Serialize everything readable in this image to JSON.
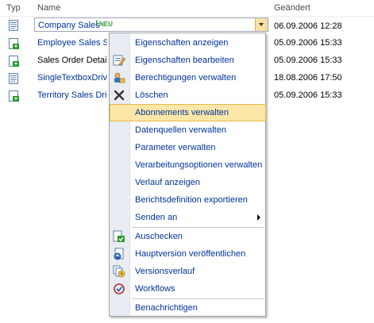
{
  "header": {
    "type_label": "Typ",
    "name_label": "Name",
    "changed_label": "Geändert"
  },
  "rows": [
    {
      "name": "Company Sales",
      "date": "06.09.2006 12:28",
      "badge": "NEU",
      "badge_mark": "!"
    },
    {
      "name": "Employee Sales Su",
      "date": "05.09.2006 15:33"
    },
    {
      "name": "Sales Order Detail",
      "date": "05.09.2006 15:33"
    },
    {
      "name": "SingleTextboxDrive",
      "date": "18.08.2006 17:50"
    },
    {
      "name": "Territory Sales Drill",
      "date": "05.09.2006 15:33"
    }
  ],
  "menu": {
    "items": [
      {
        "label": "Eigenschaften anzeigen",
        "icon": "none"
      },
      {
        "label": "Eigenschaften bearbeiten",
        "icon": "edit-properties-icon"
      },
      {
        "label": "Berechtigungen verwalten",
        "icon": "permissions-icon"
      },
      {
        "label": "Löschen",
        "icon": "delete-x-icon"
      },
      {
        "label": "Abonnements verwalten",
        "icon": "none",
        "highlighted": true
      },
      {
        "label": "Datenquellen verwalten",
        "icon": "none"
      },
      {
        "label": "Parameter verwalten",
        "icon": "none"
      },
      {
        "label": "Verarbeitungsoptionen verwalten",
        "icon": "none"
      },
      {
        "label": "Verlauf anzeigen",
        "icon": "none"
      },
      {
        "label": "Berichtsdefinition exportieren",
        "icon": "none"
      },
      {
        "label": "Senden an",
        "icon": "none",
        "submenu": true
      },
      {
        "label": "Auschecken",
        "icon": "checkout-icon"
      },
      {
        "label": "Hauptversion veröffentlichen",
        "icon": "publish-icon"
      },
      {
        "label": "Versionsverlauf",
        "icon": "version-history-icon"
      },
      {
        "label": "Workflows",
        "icon": "workflow-icon"
      },
      {
        "label": "Benachrichtigen",
        "icon": "none"
      }
    ]
  },
  "colors": {
    "link": "#003399",
    "highlight_bg": "#fce7a8",
    "highlight_border": "#e9b84a",
    "gutter": "#e9ecf2"
  }
}
